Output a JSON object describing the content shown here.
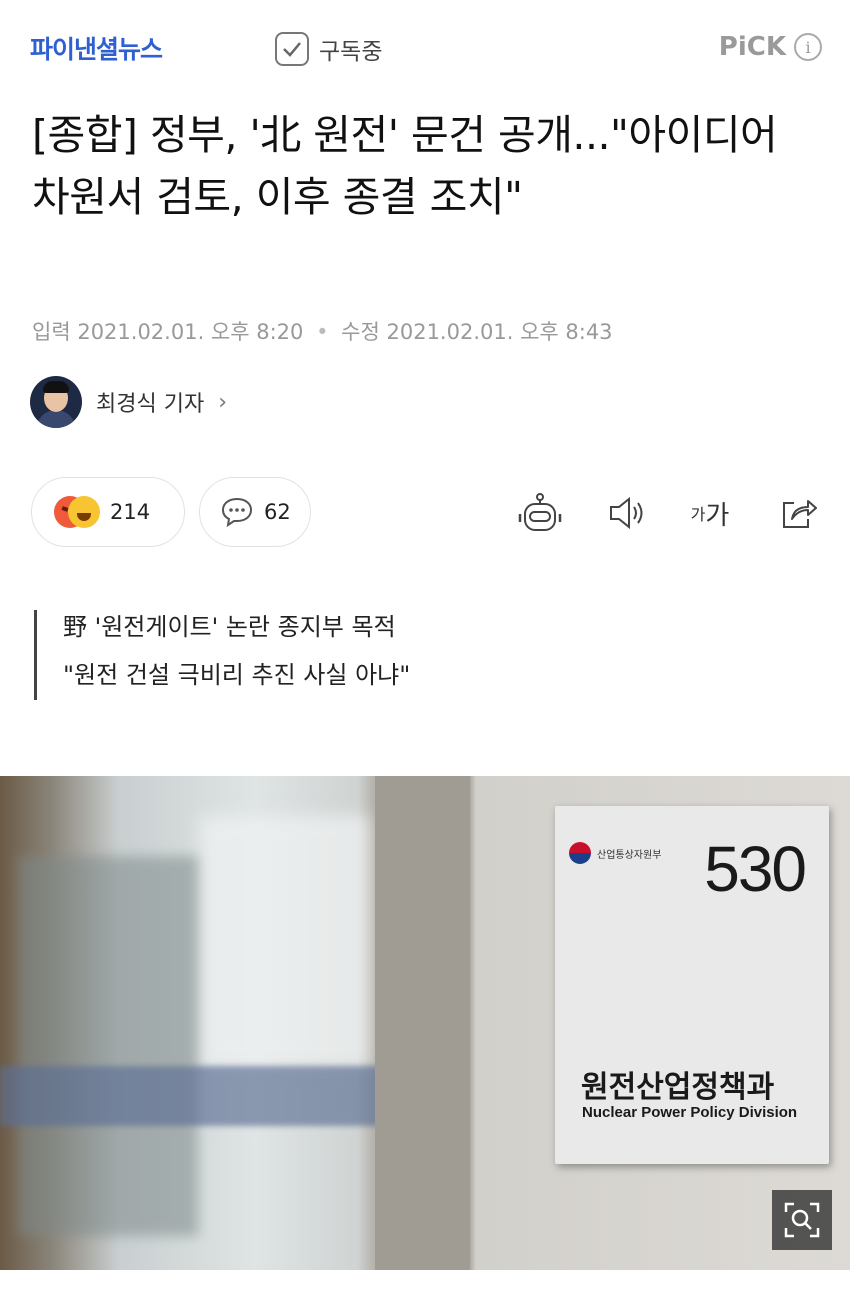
{
  "header": {
    "publisher": "파이낸셜뉴스",
    "subscribe_label": "구독중",
    "pick_label": "PiCK",
    "info_label": "i"
  },
  "article": {
    "title": "[종합] 정부, '北 원전' 문건 공개...\"아이디어 차원서 검토, 이후 종결 조치\"",
    "input_label": "입력",
    "input_date": "2021.02.01. 오후 8:20",
    "modified_label": "수정",
    "modified_date": "2021.02.01. 오후 8:43",
    "reporter": "최경식 기자",
    "reporter_chevron": "›"
  },
  "actions": {
    "reaction_count": "214",
    "comment_count": "62",
    "font_small": "가",
    "font_large": "가",
    "icons": [
      "angry-emoji-icon",
      "happy-emoji-icon",
      "comment-icon",
      "robot-icon",
      "speaker-icon",
      "font-size-icon",
      "share-icon"
    ]
  },
  "subtitle": {
    "line1": "野 '원전게이트' 논란 종지부 목적",
    "line2": "\"원전 건설 극비리 추진 사실 아냐\""
  },
  "photo": {
    "room_number": "530",
    "sign_kr": "원전산업정책과",
    "sign_en": "Nuclear Power Policy Division",
    "ministry_logo_text": "산업통상자원부",
    "zoom_icon": "zoom-icon"
  },
  "colors": {
    "brand": "#2f5fd0",
    "muted": "#999999"
  }
}
